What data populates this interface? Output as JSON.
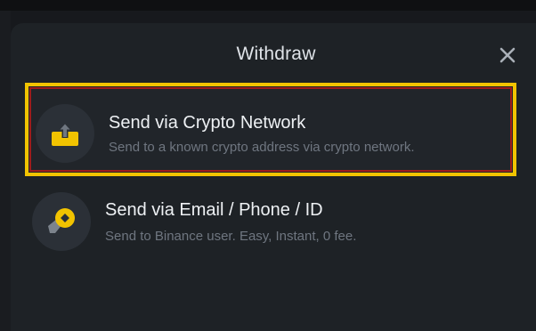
{
  "dialog": {
    "title": "Withdraw",
    "close_icon": "close-icon"
  },
  "options": [
    {
      "title": "Send via Crypto Network",
      "subtitle": "Send to a known crypto address via crypto network.",
      "icon": "upload-tray-icon",
      "highlighted": true
    },
    {
      "title": "Send via Email / Phone / ID",
      "subtitle": "Send to Binance user. Easy, Instant, 0 fee.",
      "icon": "binance-pay-icon",
      "highlighted": false
    }
  ],
  "colors": {
    "accent": "#f2c300",
    "highlight_outline": "#9e1c1c",
    "sheet_background": "#1e2226",
    "icon_circle": "#2b3037",
    "title_text": "#dfe3e8",
    "subtitle_text": "#6f7680"
  }
}
